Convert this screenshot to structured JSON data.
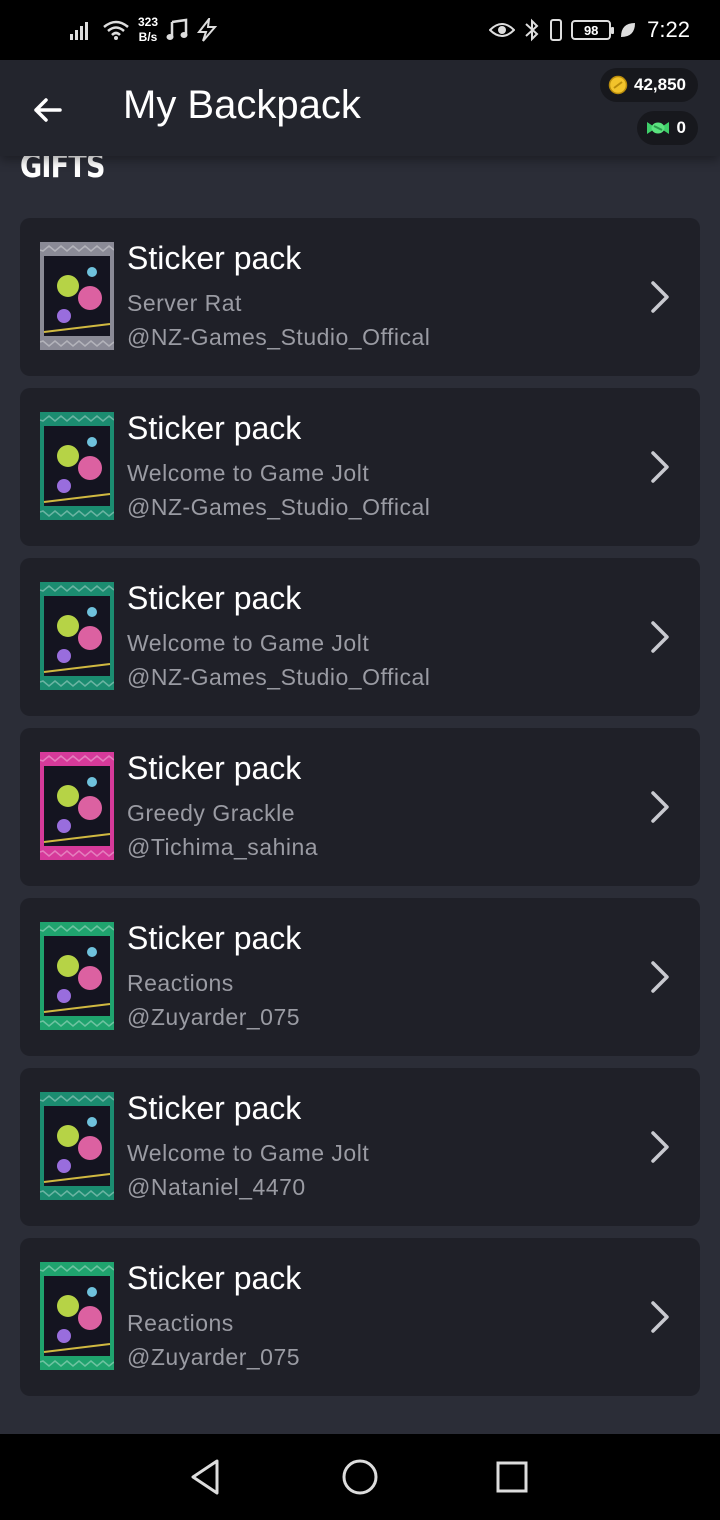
{
  "status_bar": {
    "net_speed_value": "323",
    "net_speed_unit": "B/s",
    "battery": "98",
    "time": "7:22"
  },
  "header": {
    "title": "My Backpack",
    "coins": "42,850",
    "gems": "0"
  },
  "section": {
    "title": "GIFTS"
  },
  "items": [
    {
      "title": "Sticker pack",
      "subtitle": "Server Rat",
      "user": "@NZ-Games_Studio_Offical",
      "pack_color": "#8a8a96"
    },
    {
      "title": "Sticker pack",
      "subtitle": "Welcome to Game Jolt",
      "user": "@NZ-Games_Studio_Offical",
      "pack_color": "#1b8c70"
    },
    {
      "title": "Sticker pack",
      "subtitle": "Welcome to Game Jolt",
      "user": "@NZ-Games_Studio_Offical",
      "pack_color": "#1b8c70"
    },
    {
      "title": "Sticker pack",
      "subtitle": "Greedy Grackle",
      "user": "@Tichima_sahina",
      "pack_color": "#d63a9a"
    },
    {
      "title": "Sticker pack",
      "subtitle": "Reactions",
      "user": "@Zuyarder_075",
      "pack_color": "#1fa36e"
    },
    {
      "title": "Sticker pack",
      "subtitle": "Welcome to Game Jolt",
      "user": "@Nataniel_4470",
      "pack_color": "#1b8c70"
    },
    {
      "title": "Sticker pack",
      "subtitle": "Reactions",
      "user": "@Zuyarder_075",
      "pack_color": "#1fa36e"
    }
  ]
}
